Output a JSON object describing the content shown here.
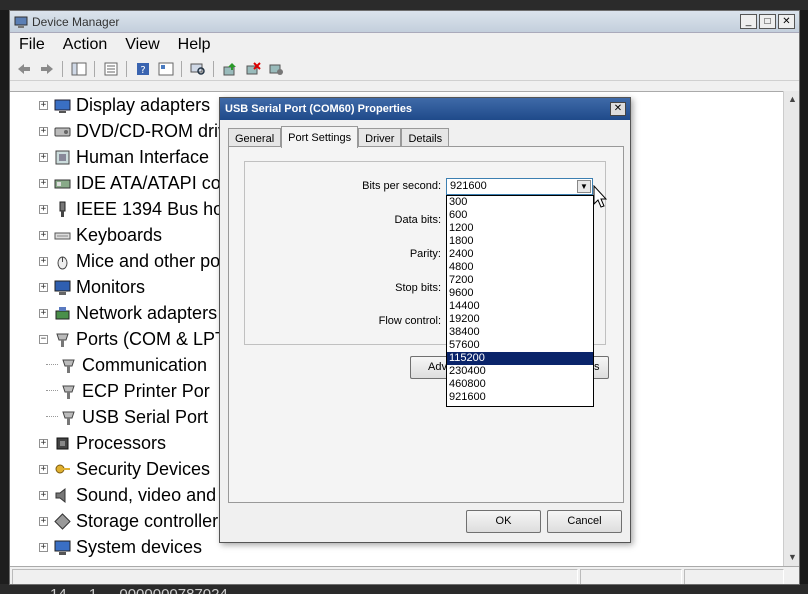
{
  "background": {
    "bottom_text": [
      "14",
      "1",
      "0000000787024"
    ]
  },
  "device_manager": {
    "title": "Device Manager",
    "menu": [
      "File",
      "Action",
      "View",
      "Help"
    ],
    "tree": [
      {
        "label": "Display adapters",
        "icon": "display-adapter-icon",
        "expander": "+"
      },
      {
        "label": "DVD/CD-ROM driv",
        "icon": "dvd-drive-icon",
        "expander": "+"
      },
      {
        "label": "Human Interface",
        "icon": "hid-icon",
        "expander": "+"
      },
      {
        "label": "IDE ATA/ATAPI co",
        "icon": "ide-controller-icon",
        "expander": "+"
      },
      {
        "label": "IEEE 1394 Bus ho",
        "icon": "ieee1394-icon",
        "expander": "+"
      },
      {
        "label": "Keyboards",
        "icon": "keyboard-icon",
        "expander": "+"
      },
      {
        "label": "Mice and other po",
        "icon": "mouse-icon",
        "expander": "+"
      },
      {
        "label": "Monitors",
        "icon": "monitor-icon",
        "expander": "+"
      },
      {
        "label": "Network adapters",
        "icon": "network-adapter-icon",
        "expander": "+"
      },
      {
        "label": "Ports (COM & LPT",
        "icon": "port-icon",
        "expander": "−"
      },
      {
        "label": "Communication",
        "icon": "port-icon",
        "child": true
      },
      {
        "label": "ECP Printer Por",
        "icon": "port-icon",
        "child": true
      },
      {
        "label": "USB Serial Port",
        "icon": "port-icon",
        "child": true
      },
      {
        "label": "Processors",
        "icon": "processor-icon",
        "expander": "+"
      },
      {
        "label": "Security Devices",
        "icon": "security-device-icon",
        "expander": "+"
      },
      {
        "label": "Sound, video and",
        "icon": "speaker-icon",
        "expander": "+"
      },
      {
        "label": "Storage controller",
        "icon": "storage-controller-icon",
        "expander": "+"
      },
      {
        "label": "System devices",
        "icon": "system-devices-icon",
        "expander": "+"
      }
    ]
  },
  "dialog": {
    "title": "USB Serial Port (COM60) Properties",
    "tabs": [
      "General",
      "Port Settings",
      "Driver",
      "Details"
    ],
    "active_tab": "Port Settings",
    "labels": {
      "bits_per_second": "Bits per second:",
      "data_bits": "Data bits:",
      "parity": "Parity:",
      "stop_bits": "Stop bits:",
      "flow_control": "Flow control:"
    },
    "bits_per_second_value": "921600",
    "bits_per_second_options": [
      "300",
      "600",
      "1200",
      "1800",
      "2400",
      "4800",
      "7200",
      "9600",
      "14400",
      "19200",
      "38400",
      "57600",
      "115200",
      "230400",
      "460800",
      "921600"
    ],
    "highlighted_option": "115200",
    "advanced_label_partial": "Adv",
    "restore_label_partial": "s",
    "ok_label": "OK",
    "cancel_label": "Cancel",
    "close_glyph": "✕"
  },
  "colors": {
    "selection": "#0a246a",
    "title_active": "#1f4a8a"
  }
}
